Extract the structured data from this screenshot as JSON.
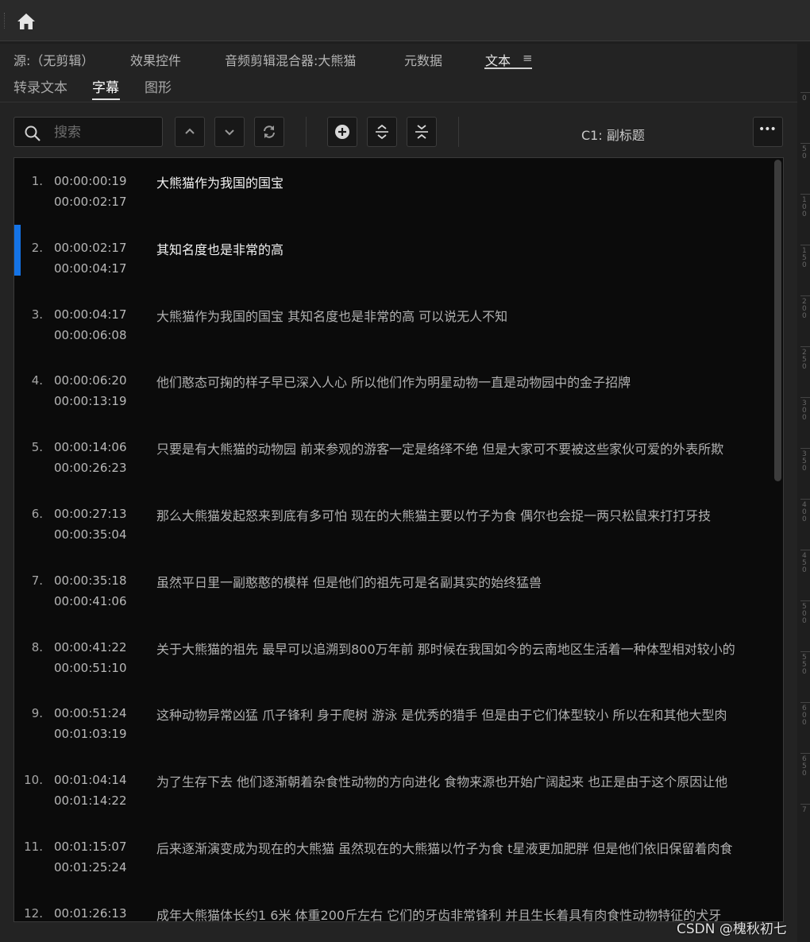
{
  "icons": {
    "home": "home-icon",
    "search": "search-icon"
  },
  "panel_tabs": [
    {
      "label": "源:（无剪辑）",
      "active": false
    },
    {
      "label": "效果控件",
      "active": false
    },
    {
      "label": "音频剪辑混合器:大熊猫",
      "active": false
    },
    {
      "label": "元数据",
      "active": false
    },
    {
      "label": "文本",
      "active": true
    }
  ],
  "panel_menu_glyph": "≡",
  "sub_tabs": [
    {
      "label": "转录文本",
      "active": false
    },
    {
      "label": "字幕",
      "active": true
    },
    {
      "label": "图形",
      "active": false
    }
  ],
  "search": {
    "placeholder": "搜索",
    "value": ""
  },
  "track_label": "C1: 副标题",
  "more_glyph": "•••",
  "accent_color": "#1473e6",
  "captions": [
    {
      "num": "1.",
      "in": "00:00:00:19",
      "out": "00:00:02:17",
      "text": "大熊猫作为我国的国宝",
      "highlight": true
    },
    {
      "num": "2.",
      "in": "00:00:02:17",
      "out": "00:00:04:17",
      "text": "其知名度也是非常的高",
      "highlight": true,
      "selected": true
    },
    {
      "num": "3.",
      "in": "00:00:04:17",
      "out": "00:00:06:08",
      "text": "大熊猫作为我国的国宝 其知名度也是非常的高 可以说无人不知"
    },
    {
      "num": "4.",
      "in": "00:00:06:20",
      "out": "00:00:13:19",
      "text": "他们憨态可掬的样子早已深入人心 所以他们作为明星动物一直是动物园中的金子招牌"
    },
    {
      "num": "5.",
      "in": "00:00:14:06",
      "out": "00:00:26:23",
      "text": "只要是有大熊猫的动物园 前来参观的游客一定是络绎不绝 但是大家可不要被这些家伙可爱的外表所欺"
    },
    {
      "num": "6.",
      "in": "00:00:27:13",
      "out": "00:00:35:04",
      "text": "那么大熊猫发起怒来到底有多可怕 现在的大熊猫主要以竹子为食 偶尔也会捉一两只松鼠来打打牙技"
    },
    {
      "num": "7.",
      "in": "00:00:35:18",
      "out": "00:00:41:06",
      "text": "虽然平日里一副憨憨的模样 但是他们的祖先可是名副其实的始终猛兽"
    },
    {
      "num": "8.",
      "in": "00:00:41:22",
      "out": "00:00:51:10",
      "text": "关于大熊猫的祖先 最早可以追溯到800万年前 那时候在我国如今的云南地区生活着一种体型相对较小的"
    },
    {
      "num": "9.",
      "in": "00:00:51:24",
      "out": "00:01:03:19",
      "text": "这种动物异常凶猛 爪子锋利 身于爬树 游泳 是优秀的猎手 但是由于它们体型较小 所以在和其他大型肉"
    },
    {
      "num": "10.",
      "in": "00:01:04:14",
      "out": "00:01:14:22",
      "text": "为了生存下去 他们逐渐朝着杂食性动物的方向进化 食物来源也开始广阔起来 也正是由于这个原因让他"
    },
    {
      "num": "11.",
      "in": "00:01:15:07",
      "out": "00:01:25:24",
      "text": "后来逐渐演变成为现在的大熊猫 虽然现在的大熊猫以竹子为食 t星液更加肥胖 但是他们依旧保留着肉食"
    },
    {
      "num": "12.",
      "in": "00:01:26:13",
      "out": "",
      "text": "成年大熊猫体长约1 6米 体重200斤左右 它们的牙齿非常锋利 并且生长着具有肉食性动物特征的犬牙"
    }
  ],
  "ruler_labels": [
    "0",
    "5 0",
    "1 0 0",
    "1 5 0",
    "2 0 0",
    "2 5 0",
    "3 0 0",
    "3 5 0",
    "4 0 0",
    "4 5 0",
    "5 0 0",
    "5 5 0",
    "6 0 0",
    "6 5 0",
    "7"
  ],
  "watermark": "CSDN @槐秋初七"
}
